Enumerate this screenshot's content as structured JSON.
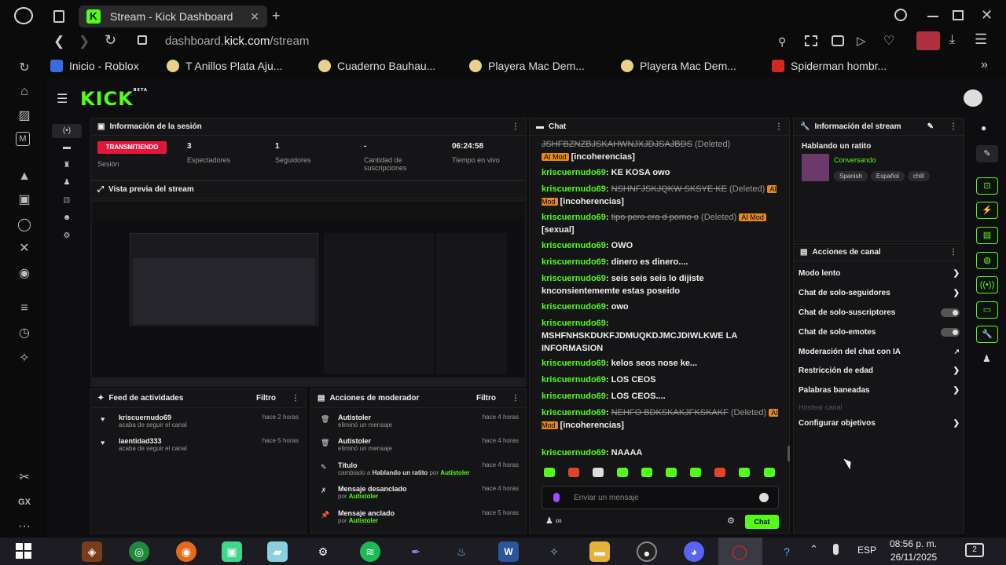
{
  "browser": {
    "tab_title": "Stream - Kick Dashboard",
    "url_prefix": "dashboard.",
    "url_domain": "kick.com",
    "url_path": "/stream",
    "bookmarks": [
      "Inicio - Roblox",
      "T Anillos Plata Aju...",
      "Cuaderno Bauhau...",
      "Playera Mac Dem...",
      "Playera Mac Dem...",
      "Spiderman hombr..."
    ]
  },
  "kick": {
    "logo": "KICK",
    "beta": "BETA"
  },
  "session": {
    "title": "Información de la sesión",
    "live_badge": "TRANSMITIENDO",
    "session_label": "Sesión",
    "stats": [
      {
        "value": "3",
        "label": "Espectadores"
      },
      {
        "value": "1",
        "label": "Seguidores"
      },
      {
        "value": "-",
        "label": "Cantidad de suscripciones"
      },
      {
        "value": "06:24:58",
        "label": "Tiempo en vivo"
      }
    ]
  },
  "preview": {
    "title": "Vista previa del stream"
  },
  "feed": {
    "title": "Feed de actividades",
    "filter": "Filtro",
    "items": [
      {
        "user": "kriscuernudo69",
        "action": "acaba de seguir el canal",
        "time": "hace 2 horas"
      },
      {
        "user": "laentidad333",
        "action": "acaba de seguir el canal",
        "time": "hace 5 horas"
      }
    ]
  },
  "mod": {
    "title": "Acciones de moderador",
    "filter": "Filtro",
    "items": [
      {
        "title": "Autistoler",
        "sub": "eliminó un mensaje",
        "time": "hace 4 horas"
      },
      {
        "title": "Autistoler",
        "sub": "eliminó un mensaje",
        "time": "hace 4 horas"
      },
      {
        "title": "Título",
        "sub_pre": "cambiado a",
        "sub_bold": "Hablando un ratito",
        "sub_mid": "por",
        "sub_user": "Autistoler",
        "time": "hace 4 horas"
      },
      {
        "title": "Mensaje desanclado",
        "sub_pre": "por",
        "sub_user": "Autistoler",
        "time": "hace 4 horas"
      },
      {
        "title": "Mensaje anclado",
        "sub_pre": "por",
        "sub_user": "Autistoler",
        "time": "hace 5 horas"
      }
    ]
  },
  "chat": {
    "title": "Chat",
    "deleted": "(Deleted)",
    "aimod": "AI Mod",
    "messages": [
      {
        "deleted_text": "JSHFBZNZBJSKAHWNJXJDJSAJBDS",
        "reason": "[incoherencias]"
      },
      {
        "user": "kriscuernudo69",
        "text": "KE KOSA owo"
      },
      {
        "user": "kriscuernudo69",
        "deleted_text": "NSHNFJSKJQKW SKSYE KE",
        "reason": "[incoherencias]"
      },
      {
        "user": "kriscuernudo69",
        "deleted_text": "tipo pero era d porno o",
        "reason": "[sexual]"
      },
      {
        "user": "kriscuernudo69",
        "text": "OWO"
      },
      {
        "user": "kriscuernudo69",
        "text": "dinero es dinero...."
      },
      {
        "user": "kriscuernudo69",
        "text": "seis seis seis lo dijiste knconsientememte estas poseido"
      },
      {
        "user": "kriscuernudo69",
        "text": "owo"
      },
      {
        "user": "kriscuernudo69",
        "text": "MSHFNHSKDUKFJDMUQKDJMCJDIWLKWE LA INFORMASION"
      },
      {
        "user": "kriscuernudo69",
        "text": "kelos seos nose ke..."
      },
      {
        "user": "kriscuernudo69",
        "text": "LOS CEOS"
      },
      {
        "user": "kriscuernudo69",
        "text": "LOS CEOS...."
      },
      {
        "user": "kriscuernudo69",
        "deleted_text": "NEHFO BDKSKAKJFKSKAKF",
        "reason": "[incoherencias]"
      },
      {
        "user": "kriscuernudo69",
        "text": "NAAAA"
      }
    ],
    "placeholder": "Enviar un mensaje",
    "send": "Chat",
    "infinity": "∞"
  },
  "streaminfo": {
    "title": "Información del stream",
    "stream_title": "Hablando un ratito",
    "category": "Conversando",
    "tags": [
      "Spanish",
      "Español",
      "chill"
    ]
  },
  "channel": {
    "title": "Acciones de canal",
    "items": [
      {
        "label": "Modo lento",
        "type": "arrow"
      },
      {
        "label": "Chat de solo-seguidores",
        "type": "arrow"
      },
      {
        "label": "Chat de solo-suscriptores",
        "type": "toggle"
      },
      {
        "label": "Chat de solo-emotes",
        "type": "toggle"
      },
      {
        "label": "Moderación del chat con IA",
        "type": "external"
      },
      {
        "label": "Restricción de edad",
        "type": "arrow"
      },
      {
        "label": "Palabras baneadas",
        "type": "arrow"
      },
      {
        "label": "Hostear canal",
        "type": "disabled"
      },
      {
        "label": "Configurar objetivos",
        "type": "arrow"
      }
    ]
  },
  "taskbar": {
    "lang": "ESP",
    "time": "08:56 p. m.",
    "date": "26/11/2025",
    "notif": "2"
  },
  "sidebar_labels": {
    "gx": "GX"
  }
}
